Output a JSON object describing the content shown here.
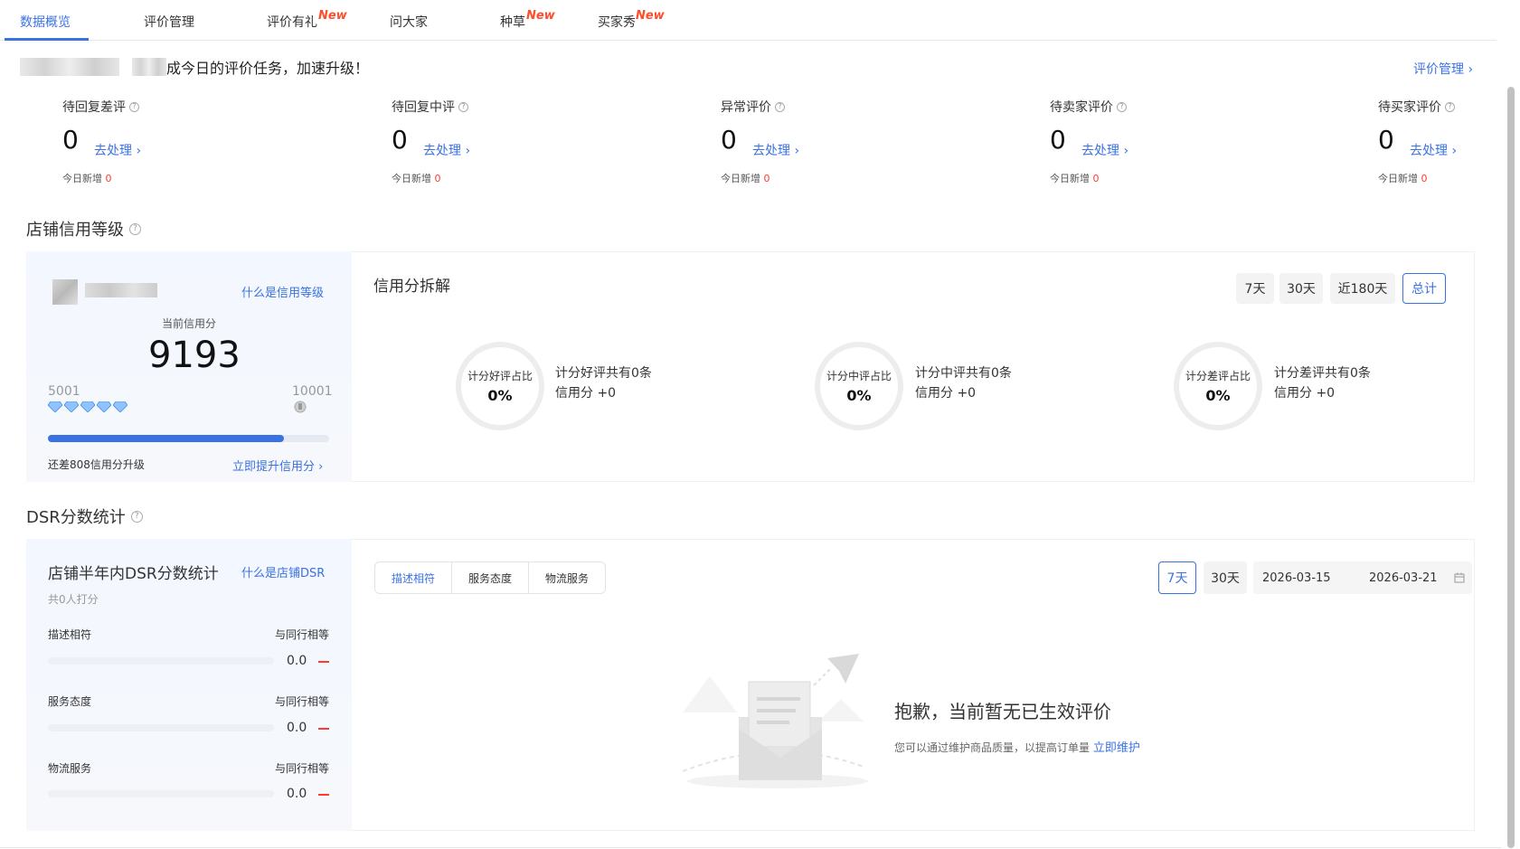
{
  "tabs": [
    {
      "label": "数据概览",
      "active": true
    },
    {
      "label": "评价管理",
      "active": false
    },
    {
      "label": "评价有礼",
      "badge": "New"
    },
    {
      "label": "问大家"
    },
    {
      "label": "种草",
      "badge": "New"
    },
    {
      "label": "买家秀",
      "badge": "New"
    }
  ],
  "header": {
    "greeting": "成今日的评价任务，加速升级！",
    "manage_link": "评价管理 ›"
  },
  "stats": [
    {
      "title": "待回复差评",
      "value": "0",
      "link": "去处理 ›",
      "new_label": "今日新增",
      "new_value": "0"
    },
    {
      "title": "待回复中评",
      "value": "0",
      "link": "去处理 ›",
      "new_label": "今日新增",
      "new_value": "0"
    },
    {
      "title": "异常评价",
      "value": "0",
      "link": "去处理 ›",
      "new_label": "今日新增",
      "new_value": "0"
    },
    {
      "title": "待卖家评价",
      "value": "0",
      "link": "去处理 ›",
      "new_label": "今日新增",
      "new_value": "0"
    },
    {
      "title": "待买家评价",
      "value": "0",
      "link": "去处理 ›",
      "new_label": "今日新增",
      "new_value": "0"
    }
  ],
  "credit": {
    "section_title": "店铺信用等级",
    "what_link": "什么是信用等级",
    "current_label": "当前信用分",
    "score": "9193",
    "range_min": "5001",
    "range_max": "10001",
    "progress": 0.838,
    "gap_text": "还差808信用分升级",
    "improve_link": "立即提升信用分 ›",
    "breakdown_title": "信用分拆解",
    "periods": [
      "7天",
      "30天",
      "近180天",
      "总计"
    ],
    "active_period": "总计",
    "items": [
      {
        "ring_label": "计分好评占比",
        "ring_value": "0%",
        "line1": "计分好评共有0条",
        "line2": "信用分 +0"
      },
      {
        "ring_label": "计分中评占比",
        "ring_value": "0%",
        "line1": "计分中评共有0条",
        "line2": "信用分 +0"
      },
      {
        "ring_label": "计分差评占比",
        "ring_value": "0%",
        "line1": "计分差评共有0条",
        "line2": "信用分 +0"
      }
    ]
  },
  "dsr": {
    "section_title": "DSR分数统计",
    "panel_title": "店铺半年内DSR分数统计",
    "what_link": "什么是店铺DSR",
    "count_text": "共0人打分",
    "rows": [
      {
        "label": "描述相符",
        "compare": "与同行相等",
        "value": "0.0"
      },
      {
        "label": "服务态度",
        "compare": "与同行相等",
        "value": "0.0"
      },
      {
        "label": "物流服务",
        "compare": "与同行相等",
        "value": "0.0"
      }
    ],
    "segments": [
      "描述相符",
      "服务态度",
      "物流服务"
    ],
    "active_segment": "描述相符",
    "periods": [
      "7天",
      "30天"
    ],
    "active_period": "7天",
    "date_start": "2026-03-15",
    "date_end": "2026-03-21",
    "empty_title": "抱歉，当前暂无已生效评价",
    "empty_sub": "您可以通过维护商品质量，以提高订单量",
    "empty_link": "立即维护"
  },
  "colors": {
    "accent": "#3a72e4",
    "new_badge": "#ff4d2d",
    "alert": "#ff3b30"
  }
}
